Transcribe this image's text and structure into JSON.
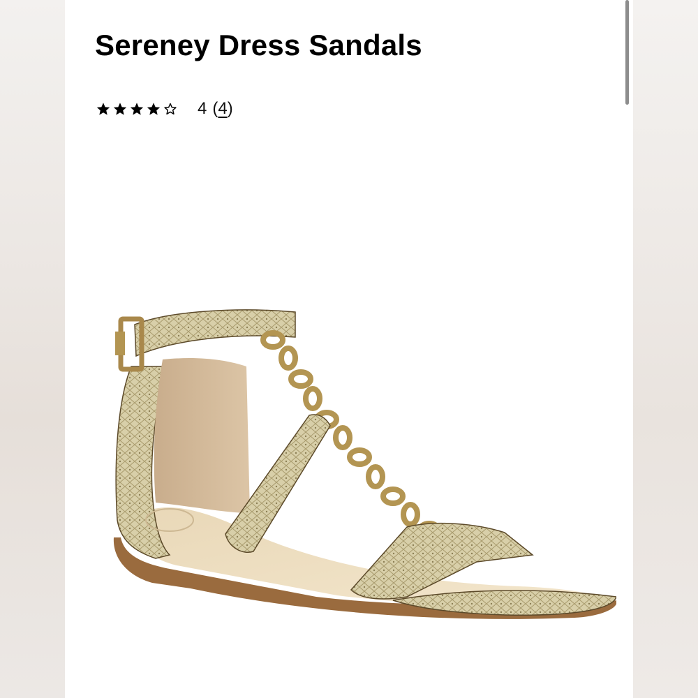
{
  "product": {
    "title": "Sereney Dress Sandals",
    "rating": {
      "stars_filled": 4,
      "stars_total": 5,
      "score_text": "4",
      "review_count": "4",
      "open_paren": "(",
      "close_paren": ")"
    },
    "image": {
      "subject": "snakeskin gladiator flat sandal with gold chain strap"
    }
  },
  "colors": {
    "text": "#000000",
    "panel_bg": "#ffffff",
    "side_bg": "#efecea",
    "scrollbar": "#8d8d8d",
    "snakeskin": "#d9cfa8",
    "chain_gold": "#b39552",
    "sole": "#9a6b3e"
  },
  "icons": {
    "filled_star": "star-filled-icon",
    "empty_star": "star-outline-icon"
  }
}
